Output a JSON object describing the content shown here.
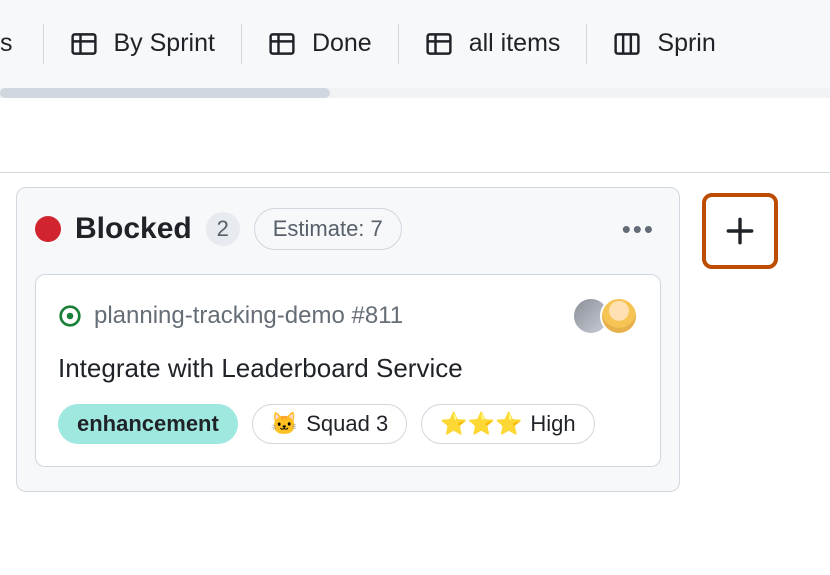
{
  "tabs": {
    "cutoff_left": "s",
    "items": [
      {
        "label": "By Sprint",
        "icon": "table"
      },
      {
        "label": "Done",
        "icon": "table"
      },
      {
        "label": "all items",
        "icon": "table"
      }
    ],
    "cutoff_right": {
      "label": "Sprin",
      "icon": "board"
    }
  },
  "column": {
    "status_color": "#d1242f",
    "title": "Blocked",
    "count": "2",
    "estimate_label": "Estimate: 7"
  },
  "card": {
    "repo_ref": "planning-tracking-demo #811",
    "title": "Integrate with Leaderboard Service",
    "labels": {
      "enhancement": "enhancement",
      "squad": {
        "emoji": "🐱",
        "text": "Squad 3"
      },
      "priority": {
        "emoji": "⭐⭐⭐",
        "text": "High"
      }
    }
  }
}
